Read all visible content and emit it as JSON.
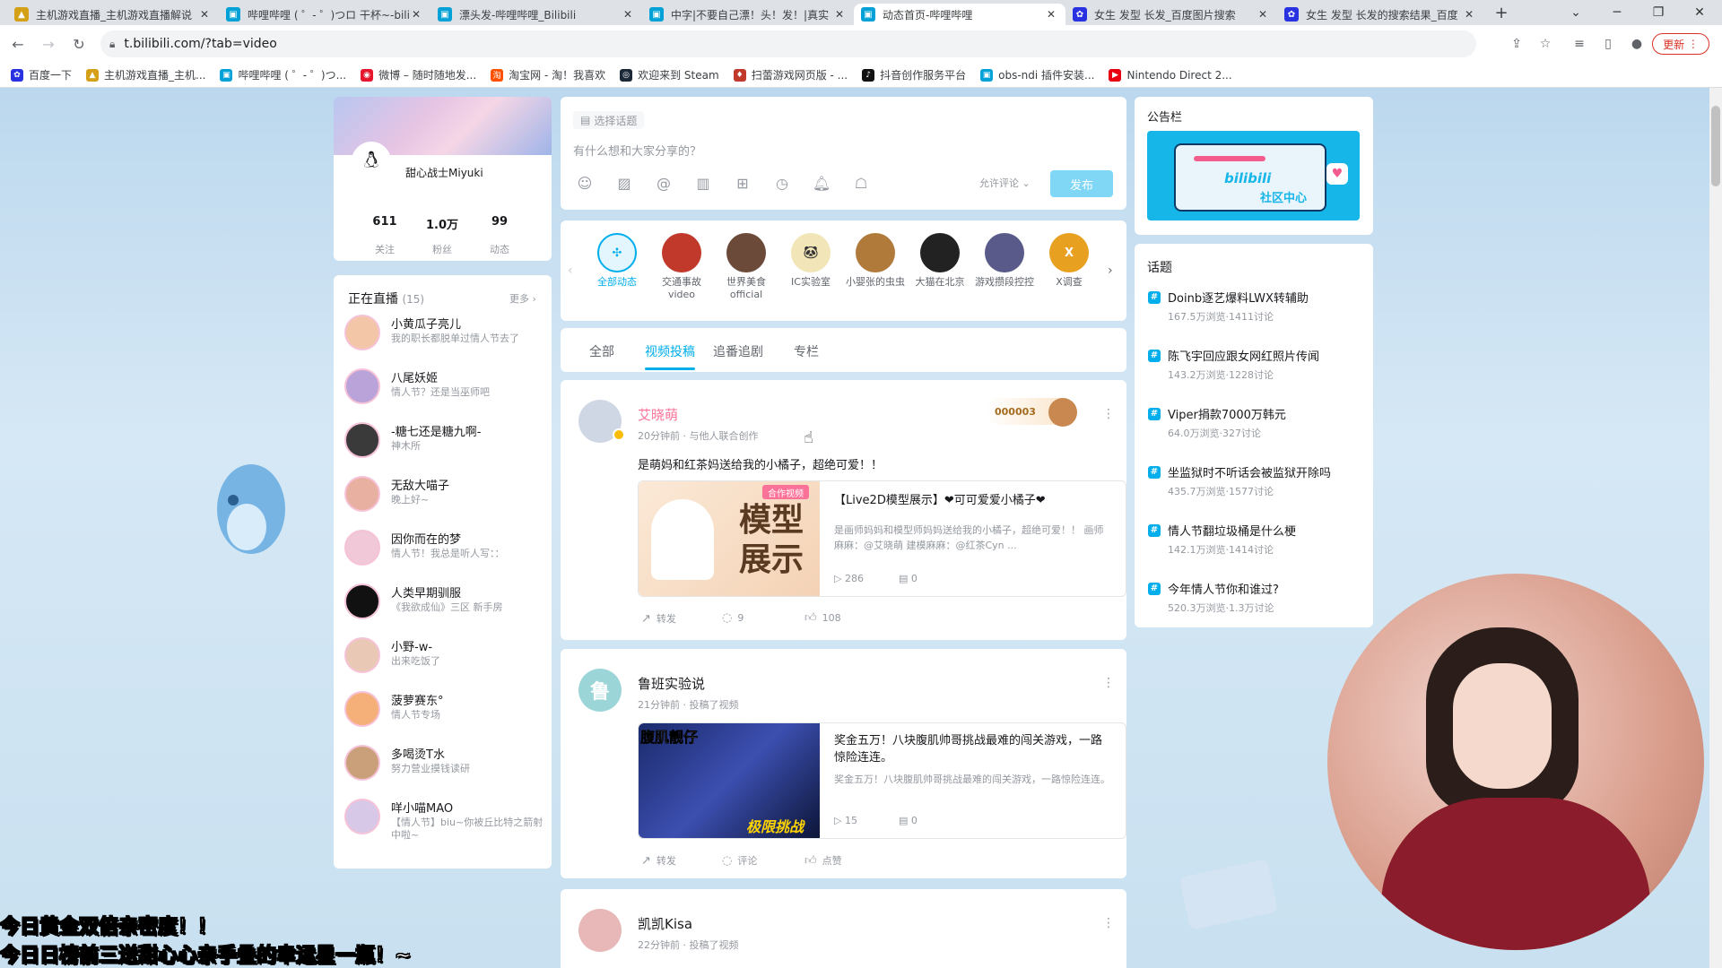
{
  "browser": {
    "tabs": [
      {
        "title": "主机游戏直播_主机游戏直播解说",
        "icon": "game-icon",
        "color": "#d4a017"
      },
      {
        "title": "哔哩哔哩 ( ゜- ゜)つロ 干杯~-bili",
        "icon": "bilibili-icon",
        "color": "#00a1d6"
      },
      {
        "title": "漂头发-哔哩哔哩_Bilibili",
        "icon": "bilibili-icon",
        "color": "#00a1d6"
      },
      {
        "title": "中字|不要自己漂！头！发！|真实",
        "icon": "bilibili-icon",
        "color": "#00a1d6"
      },
      {
        "title": "动态首页-哔哩哔哩",
        "icon": "bilibili-icon",
        "color": "#00a1d6"
      },
      {
        "title": "女生 发型 长发_百度图片搜索",
        "icon": "baidu-icon",
        "color": "#2932e1"
      },
      {
        "title": "女生 发型 长发的搜索结果_百度",
        "icon": "baidu-icon",
        "color": "#2932e1"
      }
    ],
    "new_tab": "+",
    "url": "t.bilibili.com/?tab=video",
    "update_label": "更新",
    "bookmarks": [
      {
        "label": "百度一下",
        "color": "#2932e1"
      },
      {
        "label": "主机游戏直播_主机...",
        "color": "#d4a017"
      },
      {
        "label": "哔哩哔哩 ( ゜- ゜)つ...",
        "color": "#00a1d6"
      },
      {
        "label": "微博 – 随时随地发...",
        "color": "#e6162d"
      },
      {
        "label": "淘宝网 - 淘！我喜欢",
        "color": "#ff5000"
      },
      {
        "label": "欢迎来到 Steam",
        "color": "#1b2838"
      },
      {
        "label": "扫蕾游戏网页版 - ...",
        "color": "#c0392b"
      },
      {
        "label": "抖音创作服务平台",
        "color": "#111111"
      },
      {
        "label": "obs-ndi 插件安装...",
        "color": "#00a1d6"
      },
      {
        "label": "Nintendo Direct 2...",
        "color": "#e60012"
      }
    ]
  },
  "profile": {
    "name": "甜心战士Miyuki",
    "stats": [
      {
        "value": "611",
        "label": "关注"
      },
      {
        "value": "1.0万",
        "label": "粉丝"
      },
      {
        "value": "99",
        "label": "动态"
      }
    ]
  },
  "live": {
    "title": "正在直播",
    "count": "(15)",
    "more": "更多",
    "items": [
      {
        "name": "小黄瓜子亮儿",
        "desc": "我的职长都脱单过情人节去了"
      },
      {
        "name": "八尾妖姬",
        "desc": "情人节？还是当巫师吧"
      },
      {
        "name": "-糖七还是糖九啊-",
        "desc": "神木所"
      },
      {
        "name": "无敌大喵子",
        "desc": "晚上好~"
      },
      {
        "name": "因你而在的梦",
        "desc": "情人节！我总是听人写：："
      },
      {
        "name": "人类早期驯服",
        "desc": "《我欲成仙》三区 新手房"
      },
      {
        "name": "小野-w-",
        "desc": "出来吃饭了"
      },
      {
        "name": "菠萝赛东°",
        "desc": "情人节专场"
      },
      {
        "name": "多喝烫T水",
        "desc": "努力营业摸钱读研"
      },
      {
        "name": "咩小喵MAO",
        "desc": "【情人节】biu~你被丘比特之箭射中啦~"
      }
    ]
  },
  "composer": {
    "topic_btn": "选择话题",
    "placeholder": "有什么想和大家分享的？",
    "comment_option": "允许评论",
    "publish": "发布"
  },
  "ups": [
    {
      "name": "全部动态",
      "color": "#00aeec"
    },
    {
      "name": "交通事故video",
      "color": "#c0392b"
    },
    {
      "name": "世界美食official",
      "color": "#6b4a3a"
    },
    {
      "name": "IC实验室",
      "color": "#333333"
    },
    {
      "name": "小婴张的虫虫",
      "color": "#b07a3a"
    },
    {
      "name": "大猫在北京",
      "color": "#222222"
    },
    {
      "name": "游戏攒段控控",
      "color": "#5a5a8a"
    },
    {
      "name": "X调查",
      "color": "#e8a020"
    }
  ],
  "feed_tabs": [
    "全部",
    "视频投稿",
    "追番追剧",
    "专栏"
  ],
  "posts": [
    {
      "author": "艾晓萌",
      "time": "20分钟前 · 与他人联合创作",
      "text": "是萌妈和红茶妈送给我的小橘子，超绝可爱！！",
      "badge": "合作视频",
      "thumb_text": "模型展示",
      "title": "【Live2D模型展示】❤可可爱爱小橘子❤",
      "desc": "是画师妈妈和模型师妈妈送给我的小橘子，超绝可爱！！ 画师麻麻：@艾晓萌 建模麻麻：@红茶Cyn ...",
      "plays": "286",
      "danmaku": "0",
      "forward": "转发",
      "comments": "9",
      "likes": "108",
      "fan_no": "000003"
    },
    {
      "author": "鲁班实验说",
      "time": "21分钟前 · 投稿了视频",
      "thumb_text": "腹肌靓仔",
      "thumb_text2": "极限挑战",
      "title": "奖金五万！八块腹肌帅哥挑战最难的闯关游戏，一路惊险连连。",
      "desc": "奖金五万！八块腹肌帅哥挑战最难的闯关游戏，一路惊险连连。",
      "plays": "15",
      "danmaku": "0",
      "forward": "转发",
      "comments": "评论",
      "likes": "点赞"
    },
    {
      "author": "凯凯Kisa",
      "time": "22分钟前 · 投稿了视频"
    }
  ],
  "notice": {
    "title": "公告栏",
    "banner_text": "社区中心",
    "brand": "bilibili"
  },
  "topics": {
    "title": "话题",
    "items": [
      {
        "name": "Doinb逐艺爆料LWX转辅助",
        "stat": "167.5万浏览·1411讨论"
      },
      {
        "name": "陈飞宇回应跟女网红照片传闻",
        "stat": "143.2万浏览·1228讨论"
      },
      {
        "name": "Viper捐款7000万韩元",
        "stat": "64.0万浏览·327讨论"
      },
      {
        "name": "坐监狱时不听话会被监狱开除吗",
        "stat": "435.7万浏览·1577讨论"
      },
      {
        "name": "情人节翻垃圾桶是什么梗",
        "stat": "142.1万浏览·1414讨论"
      },
      {
        "name": "今年情人节你和谁过?",
        "stat": "520.3万浏览·1.3万讨论"
      }
    ]
  },
  "overlay": {
    "line1": "今日黄金双倍亲密度！！",
    "line2": "今日日榜前三送甜心心亲手叠的幸运星一瓶！~"
  }
}
